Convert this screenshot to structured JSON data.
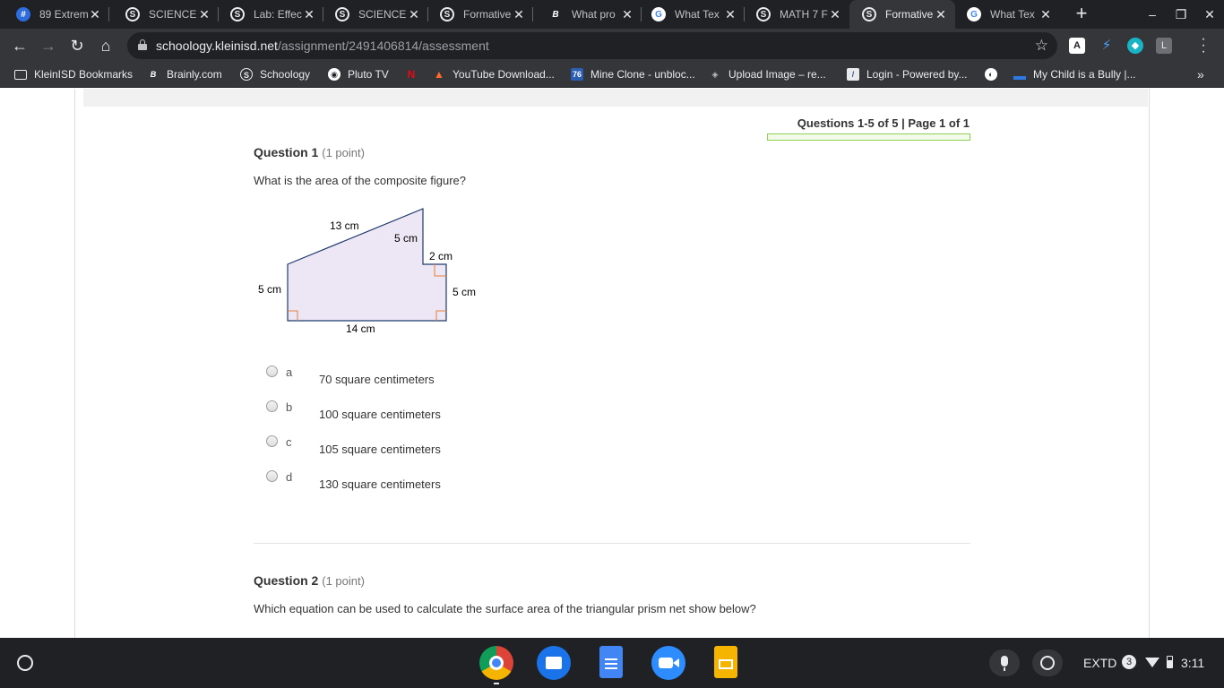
{
  "tabs": [
    {
      "title": "89 Extrem",
      "icon": "hash-icon"
    },
    {
      "title": "SCIENCE",
      "icon": "schoology-icon"
    },
    {
      "title": "Lab: Effec",
      "icon": "schoology-icon"
    },
    {
      "title": "SCIENCE",
      "icon": "schoology-icon"
    },
    {
      "title": "Formative",
      "icon": "schoology-icon"
    },
    {
      "title": "What pro",
      "icon": "brainly-icon"
    },
    {
      "title": "What Tex",
      "icon": "google-icon"
    },
    {
      "title": "MATH 7 F",
      "icon": "schoology-icon"
    },
    {
      "title": "Formative",
      "icon": "schoology-icon"
    },
    {
      "title": "What Tex",
      "icon": "google-icon"
    }
  ],
  "active_tab_index": 8,
  "address": {
    "host": "schoology.kleinisd.net",
    "path": "/assignment/2491406814/assessment"
  },
  "bookmarks": [
    {
      "label": "KleinISD Bookmarks",
      "icon": "folder-icon"
    },
    {
      "label": "Brainly.com",
      "icon": "brainly-icon"
    },
    {
      "label": "Schoology",
      "icon": "schoology-icon"
    },
    {
      "label": "Pluto TV",
      "icon": "pluto-icon"
    },
    {
      "label": "",
      "icon": "netflix-icon"
    },
    {
      "label": "YouTube Download...",
      "icon": "triangle-icon"
    },
    {
      "label": "Mine Clone - unbloc...",
      "icon": "76-icon"
    },
    {
      "label": "Upload Image – re...",
      "icon": "layers-icon"
    },
    {
      "label": "Login - Powered by...",
      "icon": "page-icon"
    },
    {
      "label": "",
      "icon": "globe-icon"
    },
    {
      "label": "My Child is a Bully |...",
      "icon": "bar-icon"
    }
  ],
  "assessment": {
    "progress_text": "Questions 1-5 of 5 | Page 1 of 1",
    "questions": [
      {
        "title": "Question 1",
        "points": "(1 point)",
        "text": "What is the area of the composite figure?",
        "figure_labels": {
          "top_slant": "13 cm",
          "inner_vertical": "5 cm",
          "step": "2 cm",
          "right_side": "5 cm",
          "left_side": "5 cm",
          "bottom": "14 cm"
        },
        "choices": [
          {
            "letter": "a",
            "text": "70 square centimeters"
          },
          {
            "letter": "b",
            "text": "100 square centimeters"
          },
          {
            "letter": "c",
            "text": "105 square centimeters"
          },
          {
            "letter": "d",
            "text": "130 square centimeters"
          }
        ]
      },
      {
        "title": "Question 2",
        "points": "(1 point)",
        "text": "Which equation can be used to calculate the surface area of the triangular prism net show below?"
      }
    ]
  },
  "shelf": {
    "apps": [
      "chrome-icon",
      "files-icon",
      "docs-icon",
      "zoom-icon",
      "slides-icon"
    ],
    "input_mode": "EXTD",
    "notification_count": "3",
    "time": "3:11"
  },
  "colors": {
    "chrome_dark": "#202124",
    "chrome_toolbar": "#35363a",
    "progress_border": "#8fd14f",
    "figure_fill": "#ede6f4",
    "figure_stroke": "#1f3a6e",
    "right_angle_marker": "#e8803a"
  }
}
